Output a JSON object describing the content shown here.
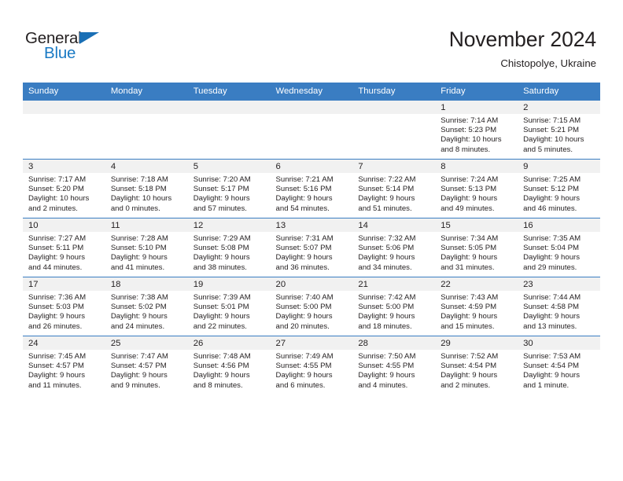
{
  "brand": {
    "name_part1": "General",
    "name_part2": "Blue",
    "triangle_color": "#1a6fb5",
    "blue_color": "#1a7ac4"
  },
  "header": {
    "title": "November 2024",
    "location": "Chistopolye, Ukraine"
  },
  "colors": {
    "header_blue": "#3a7dc2",
    "daynum_band": "#f1f1f1",
    "text": "#231f20"
  },
  "weekdays": [
    "Sunday",
    "Monday",
    "Tuesday",
    "Wednesday",
    "Thursday",
    "Friday",
    "Saturday"
  ],
  "weeks": [
    [
      {
        "day": "",
        "lines": []
      },
      {
        "day": "",
        "lines": []
      },
      {
        "day": "",
        "lines": []
      },
      {
        "day": "",
        "lines": []
      },
      {
        "day": "",
        "lines": []
      },
      {
        "day": "1",
        "lines": [
          "Sunrise: 7:14 AM",
          "Sunset: 5:23 PM",
          "Daylight: 10 hours",
          "and 8 minutes."
        ]
      },
      {
        "day": "2",
        "lines": [
          "Sunrise: 7:15 AM",
          "Sunset: 5:21 PM",
          "Daylight: 10 hours",
          "and 5 minutes."
        ]
      }
    ],
    [
      {
        "day": "3",
        "lines": [
          "Sunrise: 7:17 AM",
          "Sunset: 5:20 PM",
          "Daylight: 10 hours",
          "and 2 minutes."
        ]
      },
      {
        "day": "4",
        "lines": [
          "Sunrise: 7:18 AM",
          "Sunset: 5:18 PM",
          "Daylight: 10 hours",
          "and 0 minutes."
        ]
      },
      {
        "day": "5",
        "lines": [
          "Sunrise: 7:20 AM",
          "Sunset: 5:17 PM",
          "Daylight: 9 hours",
          "and 57 minutes."
        ]
      },
      {
        "day": "6",
        "lines": [
          "Sunrise: 7:21 AM",
          "Sunset: 5:16 PM",
          "Daylight: 9 hours",
          "and 54 minutes."
        ]
      },
      {
        "day": "7",
        "lines": [
          "Sunrise: 7:22 AM",
          "Sunset: 5:14 PM",
          "Daylight: 9 hours",
          "and 51 minutes."
        ]
      },
      {
        "day": "8",
        "lines": [
          "Sunrise: 7:24 AM",
          "Sunset: 5:13 PM",
          "Daylight: 9 hours",
          "and 49 minutes."
        ]
      },
      {
        "day": "9",
        "lines": [
          "Sunrise: 7:25 AM",
          "Sunset: 5:12 PM",
          "Daylight: 9 hours",
          "and 46 minutes."
        ]
      }
    ],
    [
      {
        "day": "10",
        "lines": [
          "Sunrise: 7:27 AM",
          "Sunset: 5:11 PM",
          "Daylight: 9 hours",
          "and 44 minutes."
        ]
      },
      {
        "day": "11",
        "lines": [
          "Sunrise: 7:28 AM",
          "Sunset: 5:10 PM",
          "Daylight: 9 hours",
          "and 41 minutes."
        ]
      },
      {
        "day": "12",
        "lines": [
          "Sunrise: 7:29 AM",
          "Sunset: 5:08 PM",
          "Daylight: 9 hours",
          "and 38 minutes."
        ]
      },
      {
        "day": "13",
        "lines": [
          "Sunrise: 7:31 AM",
          "Sunset: 5:07 PM",
          "Daylight: 9 hours",
          "and 36 minutes."
        ]
      },
      {
        "day": "14",
        "lines": [
          "Sunrise: 7:32 AM",
          "Sunset: 5:06 PM",
          "Daylight: 9 hours",
          "and 34 minutes."
        ]
      },
      {
        "day": "15",
        "lines": [
          "Sunrise: 7:34 AM",
          "Sunset: 5:05 PM",
          "Daylight: 9 hours",
          "and 31 minutes."
        ]
      },
      {
        "day": "16",
        "lines": [
          "Sunrise: 7:35 AM",
          "Sunset: 5:04 PM",
          "Daylight: 9 hours",
          "and 29 minutes."
        ]
      }
    ],
    [
      {
        "day": "17",
        "lines": [
          "Sunrise: 7:36 AM",
          "Sunset: 5:03 PM",
          "Daylight: 9 hours",
          "and 26 minutes."
        ]
      },
      {
        "day": "18",
        "lines": [
          "Sunrise: 7:38 AM",
          "Sunset: 5:02 PM",
          "Daylight: 9 hours",
          "and 24 minutes."
        ]
      },
      {
        "day": "19",
        "lines": [
          "Sunrise: 7:39 AM",
          "Sunset: 5:01 PM",
          "Daylight: 9 hours",
          "and 22 minutes."
        ]
      },
      {
        "day": "20",
        "lines": [
          "Sunrise: 7:40 AM",
          "Sunset: 5:00 PM",
          "Daylight: 9 hours",
          "and 20 minutes."
        ]
      },
      {
        "day": "21",
        "lines": [
          "Sunrise: 7:42 AM",
          "Sunset: 5:00 PM",
          "Daylight: 9 hours",
          "and 18 minutes."
        ]
      },
      {
        "day": "22",
        "lines": [
          "Sunrise: 7:43 AM",
          "Sunset: 4:59 PM",
          "Daylight: 9 hours",
          "and 15 minutes."
        ]
      },
      {
        "day": "23",
        "lines": [
          "Sunrise: 7:44 AM",
          "Sunset: 4:58 PM",
          "Daylight: 9 hours",
          "and 13 minutes."
        ]
      }
    ],
    [
      {
        "day": "24",
        "lines": [
          "Sunrise: 7:45 AM",
          "Sunset: 4:57 PM",
          "Daylight: 9 hours",
          "and 11 minutes."
        ]
      },
      {
        "day": "25",
        "lines": [
          "Sunrise: 7:47 AM",
          "Sunset: 4:57 PM",
          "Daylight: 9 hours",
          "and 9 minutes."
        ]
      },
      {
        "day": "26",
        "lines": [
          "Sunrise: 7:48 AM",
          "Sunset: 4:56 PM",
          "Daylight: 9 hours",
          "and 8 minutes."
        ]
      },
      {
        "day": "27",
        "lines": [
          "Sunrise: 7:49 AM",
          "Sunset: 4:55 PM",
          "Daylight: 9 hours",
          "and 6 minutes."
        ]
      },
      {
        "day": "28",
        "lines": [
          "Sunrise: 7:50 AM",
          "Sunset: 4:55 PM",
          "Daylight: 9 hours",
          "and 4 minutes."
        ]
      },
      {
        "day": "29",
        "lines": [
          "Sunrise: 7:52 AM",
          "Sunset: 4:54 PM",
          "Daylight: 9 hours",
          "and 2 minutes."
        ]
      },
      {
        "day": "30",
        "lines": [
          "Sunrise: 7:53 AM",
          "Sunset: 4:54 PM",
          "Daylight: 9 hours",
          "and 1 minute."
        ]
      }
    ]
  ]
}
